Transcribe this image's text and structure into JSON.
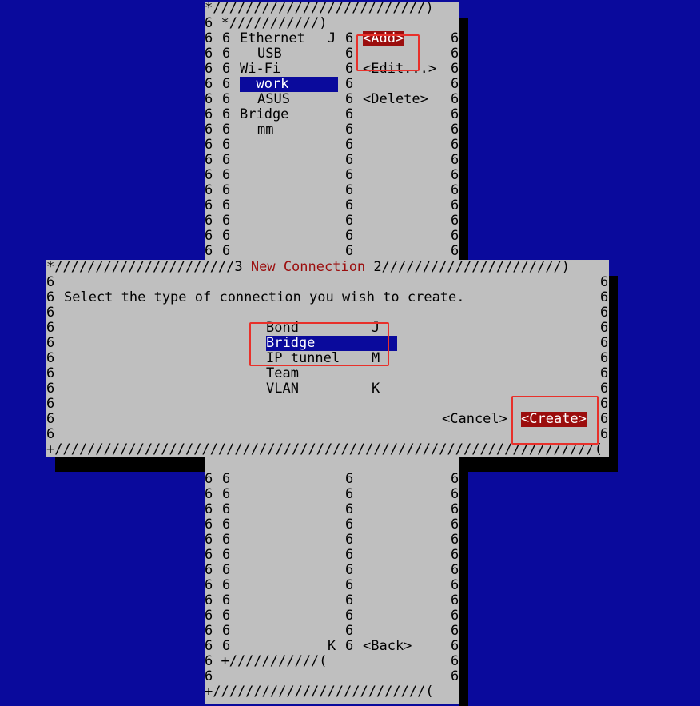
{
  "main": {
    "top_border": "*//////////////////////////)",
    "list_top_border": "6 *///////////)",
    "list_bottom_border": "6 +///////////(",
    "bottom_border": "+//////////////////////////(",
    "left_border_glyph": "6",
    "list_border_glyph": "6",
    "right_border_glyph": "6",
    "connections": [
      {
        "label": "Ethernet",
        "indent": 0,
        "mark": "J",
        "selected": false
      },
      {
        "label": "USB",
        "indent": 2,
        "mark": "",
        "selected": false
      },
      {
        "label": "Wi-Fi",
        "indent": 0,
        "mark": "",
        "selected": false
      },
      {
        "label": "work",
        "indent": 2,
        "mark": "",
        "selected": true
      },
      {
        "label": "ASUS",
        "indent": 2,
        "mark": "",
        "selected": false
      },
      {
        "label": "Bridge",
        "indent": 0,
        "mark": "",
        "selected": false
      },
      {
        "label": "mm",
        "indent": 2,
        "mark": "",
        "selected": false
      }
    ],
    "scroll_mark": "K",
    "buttons": {
      "add": "<Add>",
      "edit": "<Edit...>",
      "delete": "<Delete>",
      "back": "<Back>"
    }
  },
  "dialog": {
    "title_prefix": "*//////////////////////3 ",
    "title": "New Connection",
    "title_suffix": " 2//////////////////////)",
    "bottom_border": "+//////////////////////////////////////////////////////////////////(",
    "border_glyph": "6",
    "prompt": "Select the type of connection you wish to create.",
    "options": [
      {
        "label": "Bond",
        "mark": "J",
        "selected": false
      },
      {
        "label": "Bridge",
        "mark": "",
        "selected": true
      },
      {
        "label": "IP tunnel",
        "mark": "M",
        "selected": false
      },
      {
        "label": "Team",
        "mark": "",
        "selected": false
      },
      {
        "label": "VLAN",
        "mark": "K",
        "selected": false
      }
    ],
    "cancel": "<Cancel>",
    "create": "<Create>"
  },
  "colors": {
    "background": "#0a0a9c",
    "panel": "#bfbfbf",
    "selection": "#0a0a9c",
    "focused_button": "#9b0d0d",
    "annotation": "#e8302a"
  }
}
